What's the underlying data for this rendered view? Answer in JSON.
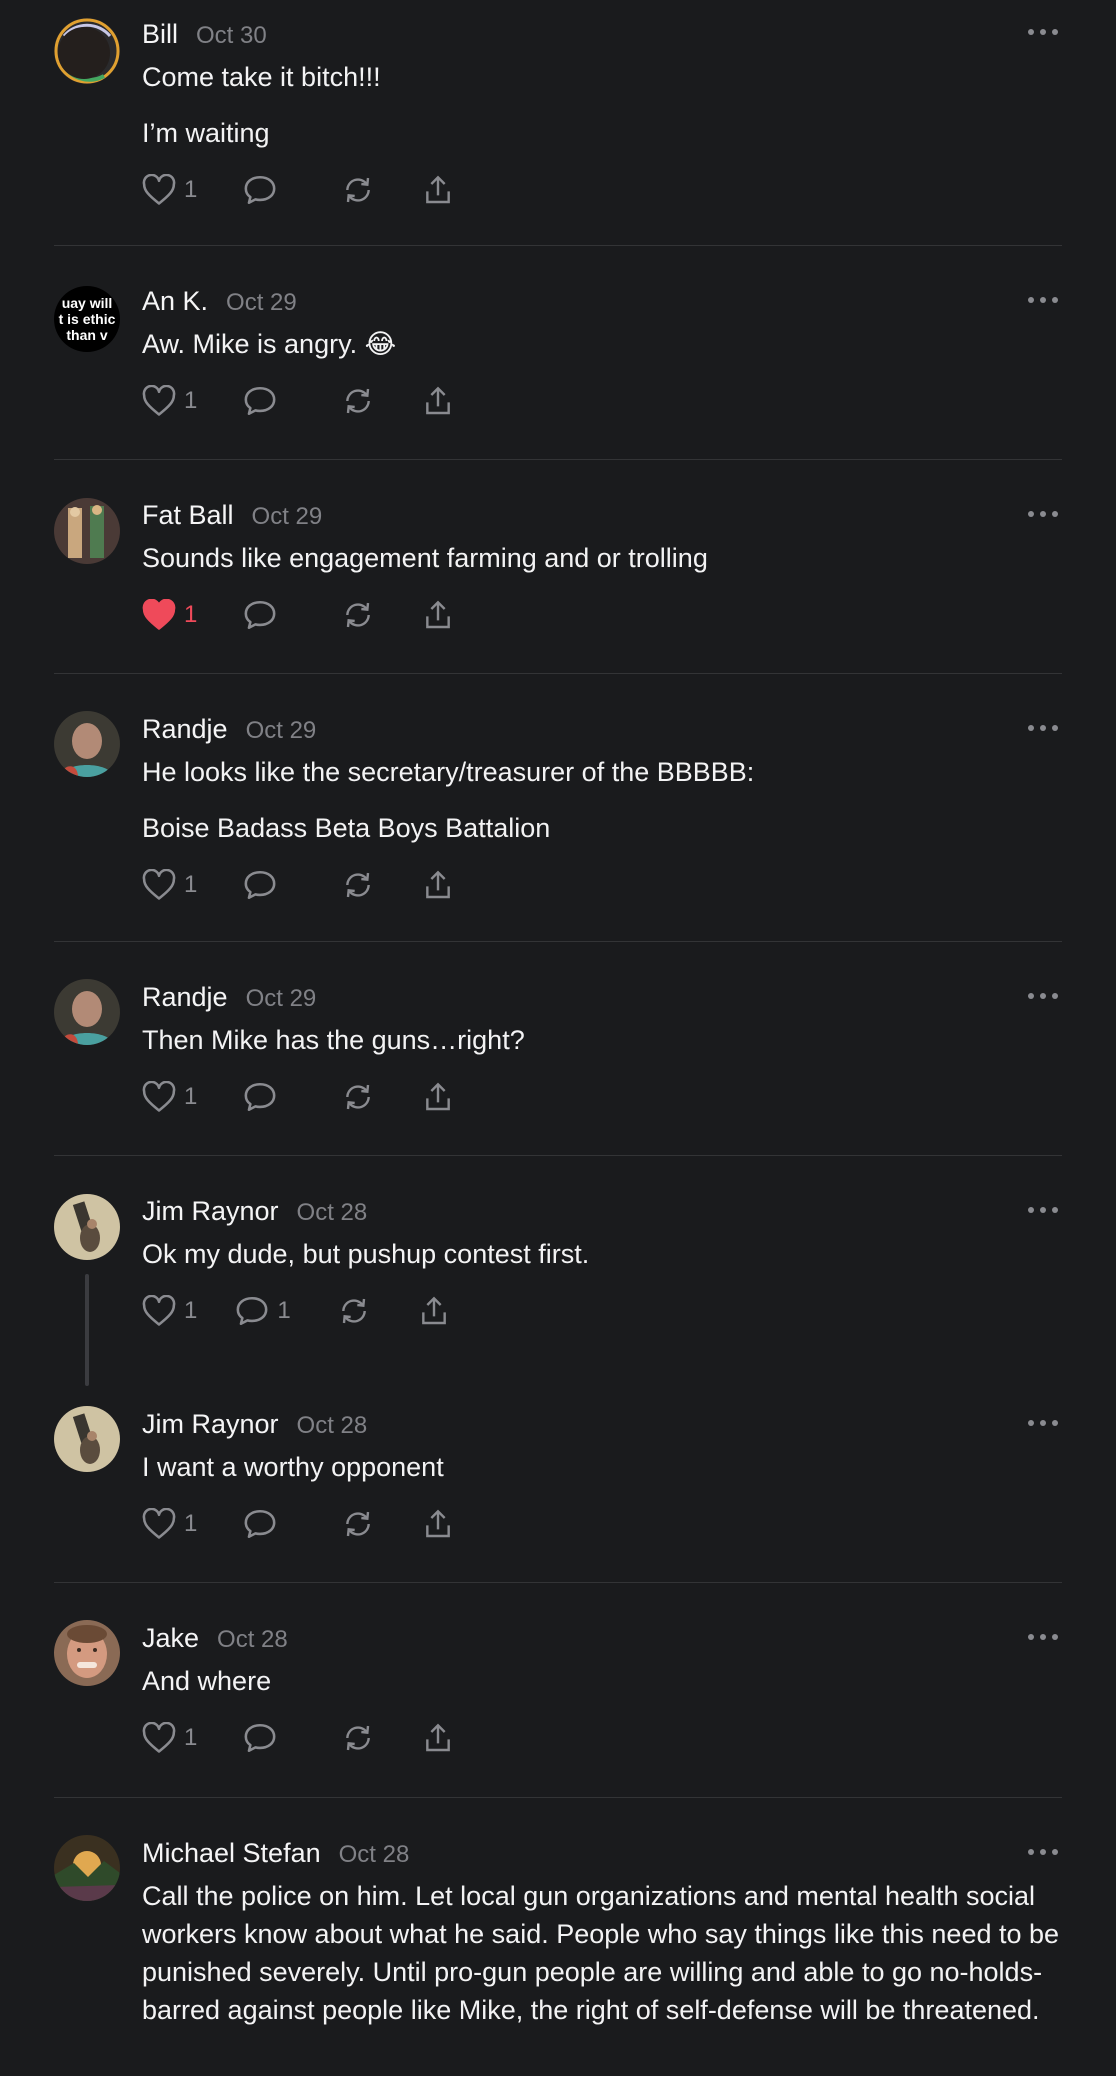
{
  "posts": [
    {
      "name": "Bill",
      "date": "Oct 30",
      "paragraphs": [
        "Come take it bitch!!!",
        "I’m waiting"
      ],
      "likes": "1",
      "replies": "",
      "liked": false
    },
    {
      "name": "An K.",
      "date": "Oct 29",
      "paragraphs": [
        "Aw. Mike is angry. 😂"
      ],
      "likes": "1",
      "replies": "",
      "liked": false,
      "avatar_text": [
        "uay will",
        "t is ethic",
        "than v"
      ]
    },
    {
      "name": "Fat Ball",
      "date": "Oct 29",
      "paragraphs": [
        "Sounds like engagement farming and or trolling"
      ],
      "likes": "1",
      "replies": "",
      "liked": true
    },
    {
      "name": "Randje",
      "date": "Oct 29",
      "paragraphs": [
        "He looks like the secretary/treasurer of the BBBBB:",
        "Boise Badass Beta Boys Battalion"
      ],
      "likes": "1",
      "replies": "",
      "liked": false
    },
    {
      "name": "Randje",
      "date": "Oct 29",
      "paragraphs": [
        "Then Mike has the guns…right?"
      ],
      "likes": "1",
      "replies": "",
      "liked": false
    },
    {
      "name": "Jim Raynor",
      "date": "Oct 28",
      "paragraphs": [
        "Ok my dude, but pushup contest first."
      ],
      "likes": "1",
      "replies": "1",
      "liked": false
    },
    {
      "name": "Jim Raynor",
      "date": "Oct 28",
      "paragraphs": [
        "I want a worthy opponent"
      ],
      "likes": "1",
      "replies": "",
      "liked": false
    },
    {
      "name": "Jake",
      "date": "Oct 28",
      "paragraphs": [
        "And where"
      ],
      "likes": "1",
      "replies": "",
      "liked": false
    },
    {
      "name": "Michael Stefan",
      "date": "Oct 28",
      "paragraphs": [
        "Call the police on him. Let local gun organizations and mental health social workers know about what he said. People who say things like this need to be punished severely. Until pro-gun people are willing and able to go no-holds-barred against people like Mike, the right of self-defense will be threatened."
      ],
      "likes": "",
      "replies": "",
      "liked": false
    }
  ],
  "colors": {
    "background": "#1a1b1d",
    "like_active": "#ef4a5a",
    "muted": "#8a8b90"
  },
  "icons": [
    "heart-icon",
    "comment-icon",
    "repost-icon",
    "share-icon",
    "more-icon"
  ]
}
